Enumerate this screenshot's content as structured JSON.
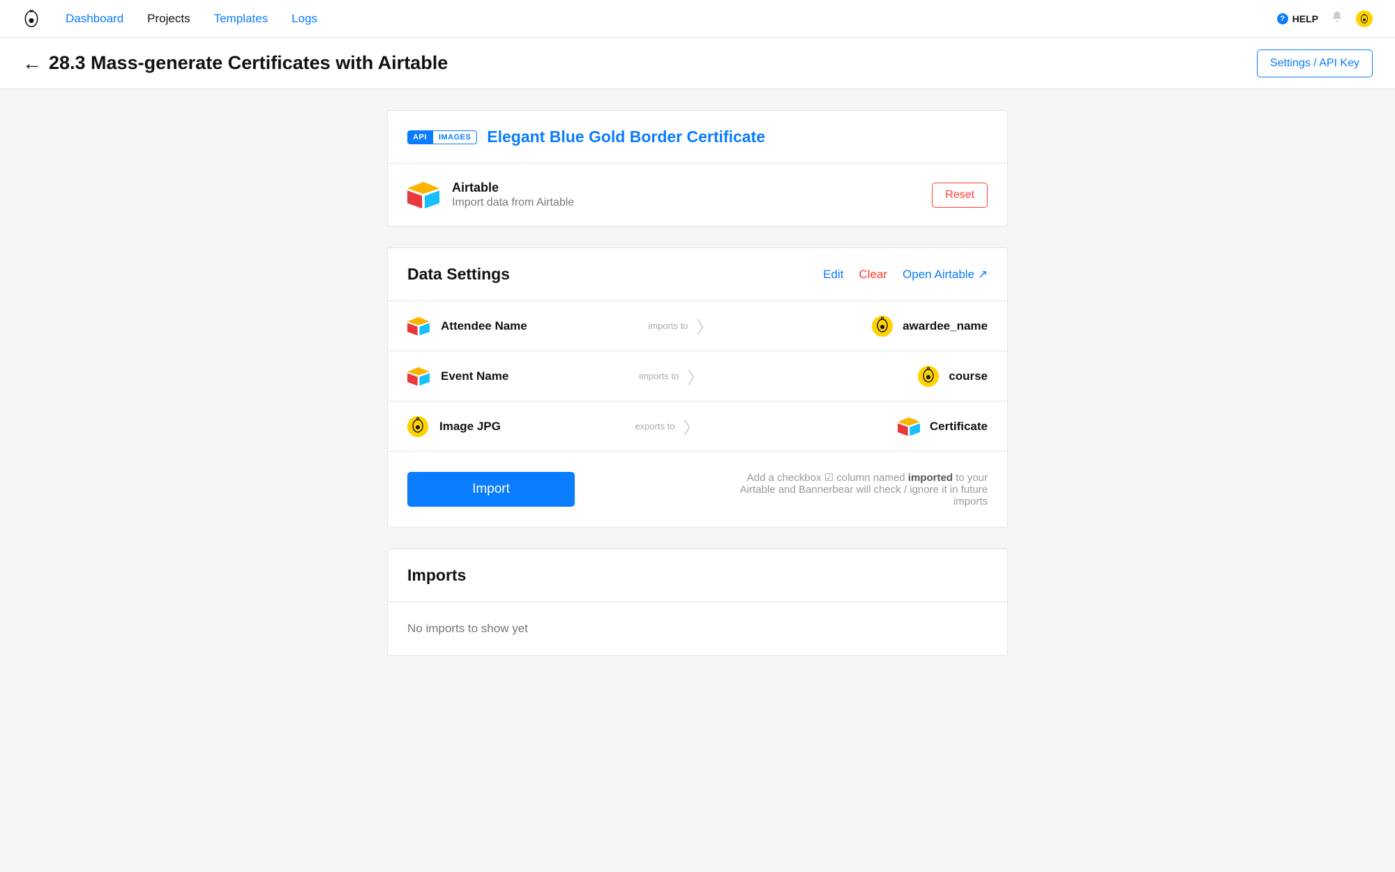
{
  "nav": {
    "items": [
      {
        "label": "Dashboard",
        "active": false
      },
      {
        "label": "Projects",
        "active": true
      },
      {
        "label": "Templates",
        "active": false
      },
      {
        "label": "Logs",
        "active": false
      }
    ],
    "help": "HELP"
  },
  "header": {
    "title": "28.3 Mass-generate Certificates with Airtable",
    "settings_btn": "Settings / API Key"
  },
  "template_card": {
    "tags": {
      "api": "API",
      "images": "IMAGES"
    },
    "name": "Elegant Blue Gold Border Certificate",
    "integration_name": "Airtable",
    "integration_sub": "Import data from Airtable",
    "reset": "Reset"
  },
  "data_settings": {
    "title": "Data Settings",
    "links": {
      "edit": "Edit",
      "clear": "Clear",
      "open": "Open Airtable"
    },
    "rows": [
      {
        "left_kind": "airtable",
        "left": "Attendee Name",
        "dir": "imports to",
        "right_kind": "bb",
        "right": "awardee_name"
      },
      {
        "left_kind": "airtable",
        "left": "Event Name",
        "dir": "imports to",
        "right_kind": "bb",
        "right": "course"
      },
      {
        "left_kind": "bb",
        "left": "Image JPG",
        "dir": "exports to",
        "right_kind": "airtable",
        "right": "Certificate"
      }
    ],
    "import_btn": "Import",
    "hint_pre": "Add a checkbox ☑ column named ",
    "hint_bold": "imported",
    "hint_post": " to your Airtable and Bannerbear will check / ignore it in future imports"
  },
  "imports": {
    "title": "Imports",
    "empty": "No imports to show yet"
  }
}
